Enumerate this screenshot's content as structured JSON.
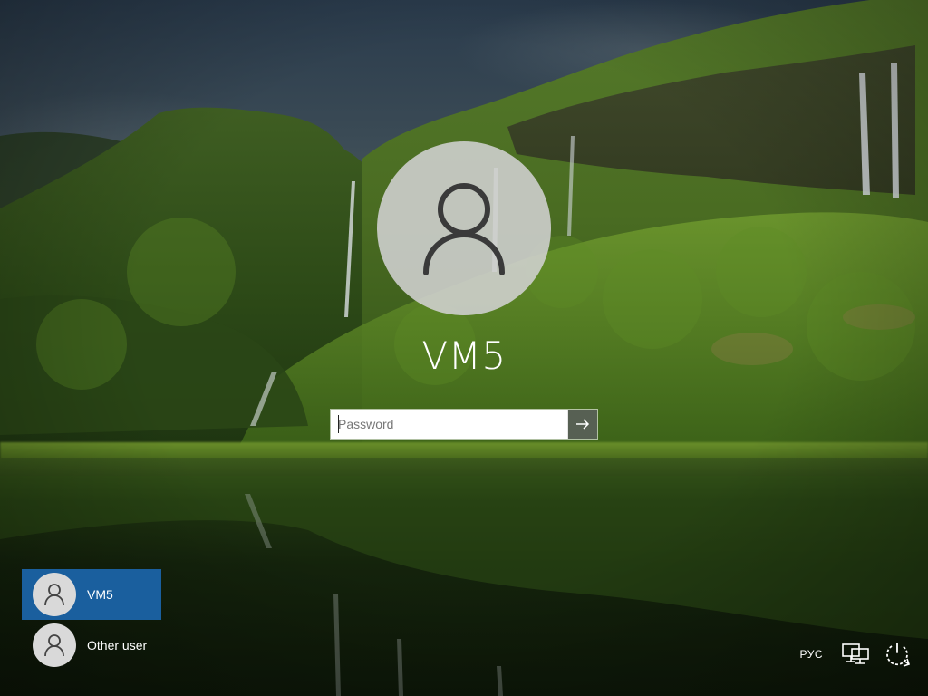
{
  "login": {
    "username": "VM5",
    "password_placeholder": "Password",
    "submit_icon": "arrow-right-icon"
  },
  "user_list": {
    "users": [
      {
        "name": "VM5",
        "selected": true,
        "icon": "user-icon"
      },
      {
        "name": "Other user",
        "selected": false,
        "icon": "user-icon"
      }
    ]
  },
  "tray": {
    "language": "РУС",
    "network_icon": "network-icon",
    "power_icon": "power-icon"
  },
  "colors": {
    "selected_user_bg": "#1a5f9e",
    "avatar_bg": "#d2d2d2"
  }
}
